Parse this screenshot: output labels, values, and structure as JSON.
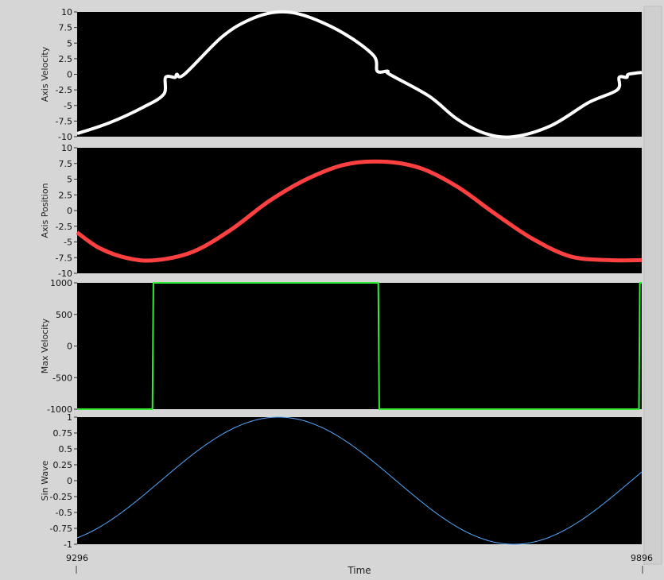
{
  "chart_data": [
    {
      "type": "line",
      "ylabel": "Axis Velocity",
      "ylim": [
        -10,
        10
      ],
      "yticks": [
        "10",
        "7.5",
        "5",
        "2.5",
        "0",
        "-2.5",
        "-5",
        "-7.5",
        "-10"
      ],
      "series": [
        {
          "color": "#ffffff",
          "x": [
            9296,
            9330,
            9366,
            9388,
            9390,
            9400,
            9402,
            9410,
            9450,
            9480,
            9510,
            9540,
            9580,
            9611,
            9615,
            9626,
            9628,
            9670,
            9700,
            9730,
            9760,
            9800,
            9840,
            9870,
            9872,
            9880,
            9882,
            9896
          ],
          "values": [
            -9.5,
            -7.8,
            -5.3,
            -3.2,
            -0.5,
            -0.5,
            0,
            0,
            6.0,
            8.8,
            10.0,
            9.3,
            6.5,
            3.0,
            0.5,
            0.5,
            0,
            -3.5,
            -7.2,
            -9.5,
            -10.0,
            -8.2,
            -4.5,
            -2.5,
            -0.5,
            -0.5,
            0,
            0.3
          ]
        }
      ]
    },
    {
      "type": "line",
      "ylabel": "Axis Position",
      "ylim": [
        -10,
        10
      ],
      "yticks": [
        "10",
        "7.5",
        "5",
        "2.5",
        "0",
        "-2.5",
        "-5",
        "-7.5",
        "-10"
      ],
      "series": [
        {
          "color": "#ff4040",
          "x": [
            9296,
            9320,
            9350,
            9380,
            9420,
            9460,
            9500,
            9540,
            9580,
            9620,
            9660,
            9700,
            9740,
            9780,
            9820,
            9860,
            9896
          ],
          "values": [
            -3.5,
            -6.0,
            -7.6,
            -7.9,
            -6.5,
            -3.0,
            1.5,
            5.0,
            7.3,
            7.8,
            6.8,
            3.8,
            -0.5,
            -4.5,
            -7.3,
            -7.9,
            -7.9
          ]
        }
      ]
    },
    {
      "type": "line",
      "ylabel": "Max Velocity",
      "ylim": [
        -1000,
        1000
      ],
      "yticks": [
        "1000",
        "500",
        "0",
        "-500",
        "-1000"
      ],
      "series": [
        {
          "color": "#33ee33",
          "x": [
            9296,
            9376,
            9377,
            9616,
            9617,
            9893,
            9894,
            9896
          ],
          "values": [
            -1000,
            -1000,
            1000,
            1000,
            -1000,
            -1000,
            1000,
            1000
          ]
        }
      ]
    },
    {
      "type": "line",
      "ylabel": "Sin Wave",
      "xlabel": "Time",
      "ylim": [
        -1,
        1
      ],
      "xlim": [
        9296,
        9896
      ],
      "xticks": [
        "9296",
        "9896"
      ],
      "yticks": [
        "1",
        "0.75",
        "0.5",
        "0.25",
        "0",
        "-0.25",
        "-0.5",
        "-0.75",
        "-1"
      ],
      "series": [
        {
          "color": "#55aaff",
          "wave": {
            "amplitude": 1,
            "period": 500,
            "peak_at": 9510
          }
        }
      ]
    }
  ]
}
